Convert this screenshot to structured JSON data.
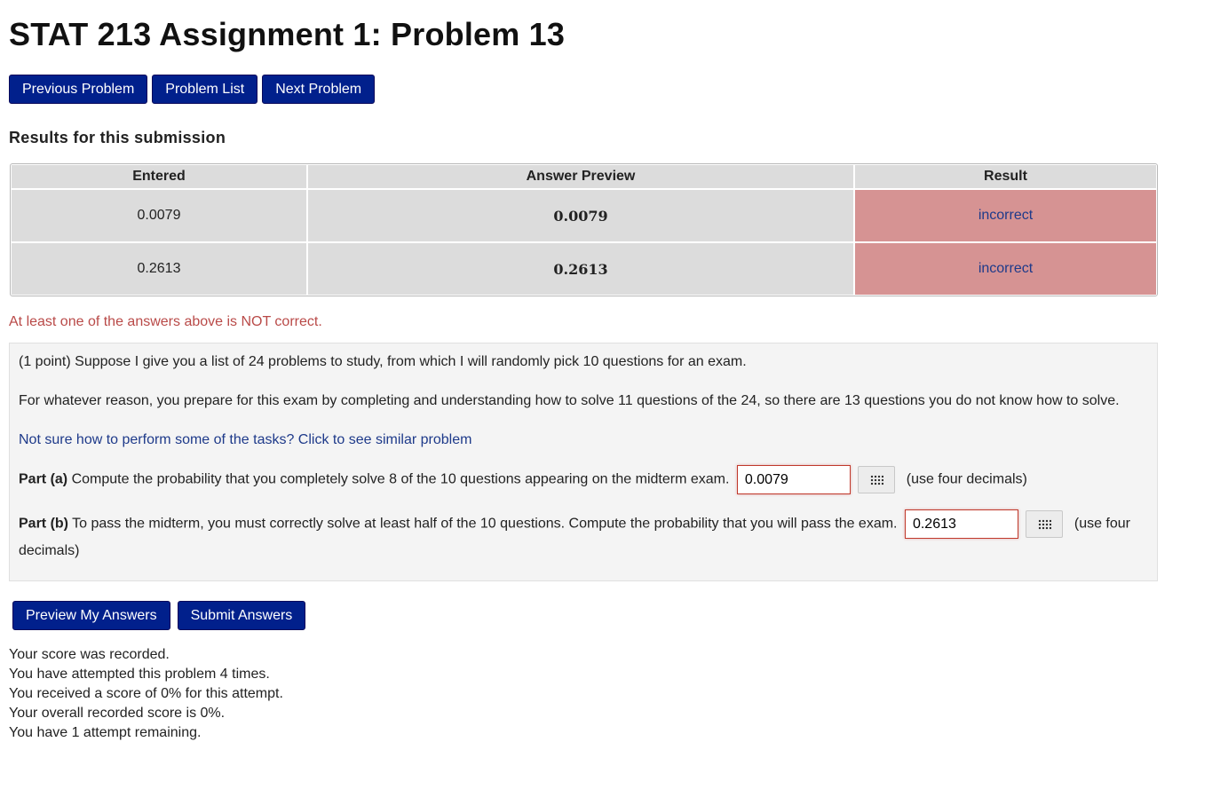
{
  "title": "STAT 213 Assignment 1: Problem 13",
  "nav": {
    "previous": "Previous Problem",
    "list": "Problem List",
    "next": "Next Problem"
  },
  "results": {
    "heading": "Results for this submission",
    "columns": [
      "Entered",
      "Answer Preview",
      "Result"
    ],
    "rows": [
      {
        "entered": "0.0079",
        "preview": "0.0079",
        "result": "incorrect"
      },
      {
        "entered": "0.2613",
        "preview": "0.2613",
        "result": "incorrect"
      }
    ],
    "warning": "At least one of the answers above is NOT correct."
  },
  "problem": {
    "intro": "(1 point) Suppose I give you a list of 24 problems to study, from which I will randomly pick 10 questions for an exam.",
    "detail": "For whatever reason, you prepare for this exam by completing and understanding how to solve 11 questions of the 24, so there are 13 questions you do not know how to solve.",
    "help_link": "Not sure how to perform some of the tasks? Click to see similar problem",
    "part_a": {
      "label": "Part (a)",
      "text": " Compute the probability that you completely solve 8 of the 10 questions appearing on the midterm exam.",
      "value": "0.0079",
      "hint": "(use four decimals)"
    },
    "part_b": {
      "label": "Part (b)",
      "text": " To pass the midterm, you must correctly solve at least half of the 10 questions. Compute the probability that you will pass the exam.",
      "value": "0.2613",
      "hint": "(use four decimals)"
    }
  },
  "actions": {
    "preview": "Preview My Answers",
    "submit": "Submit Answers"
  },
  "score": {
    "line1": "Your score was recorded.",
    "line2": "You have attempted this problem 4 times.",
    "line3": "You received a score of 0% for this attempt.",
    "line4": "Your overall recorded score is 0%.",
    "line5": "You have 1 attempt remaining."
  },
  "colors": {
    "button": "#01208c",
    "incorrect_cell": "#d69393",
    "warning_text": "#b94a48",
    "link": "#1e3a8a"
  },
  "icons": {
    "equation_editor": "grid-icon"
  }
}
